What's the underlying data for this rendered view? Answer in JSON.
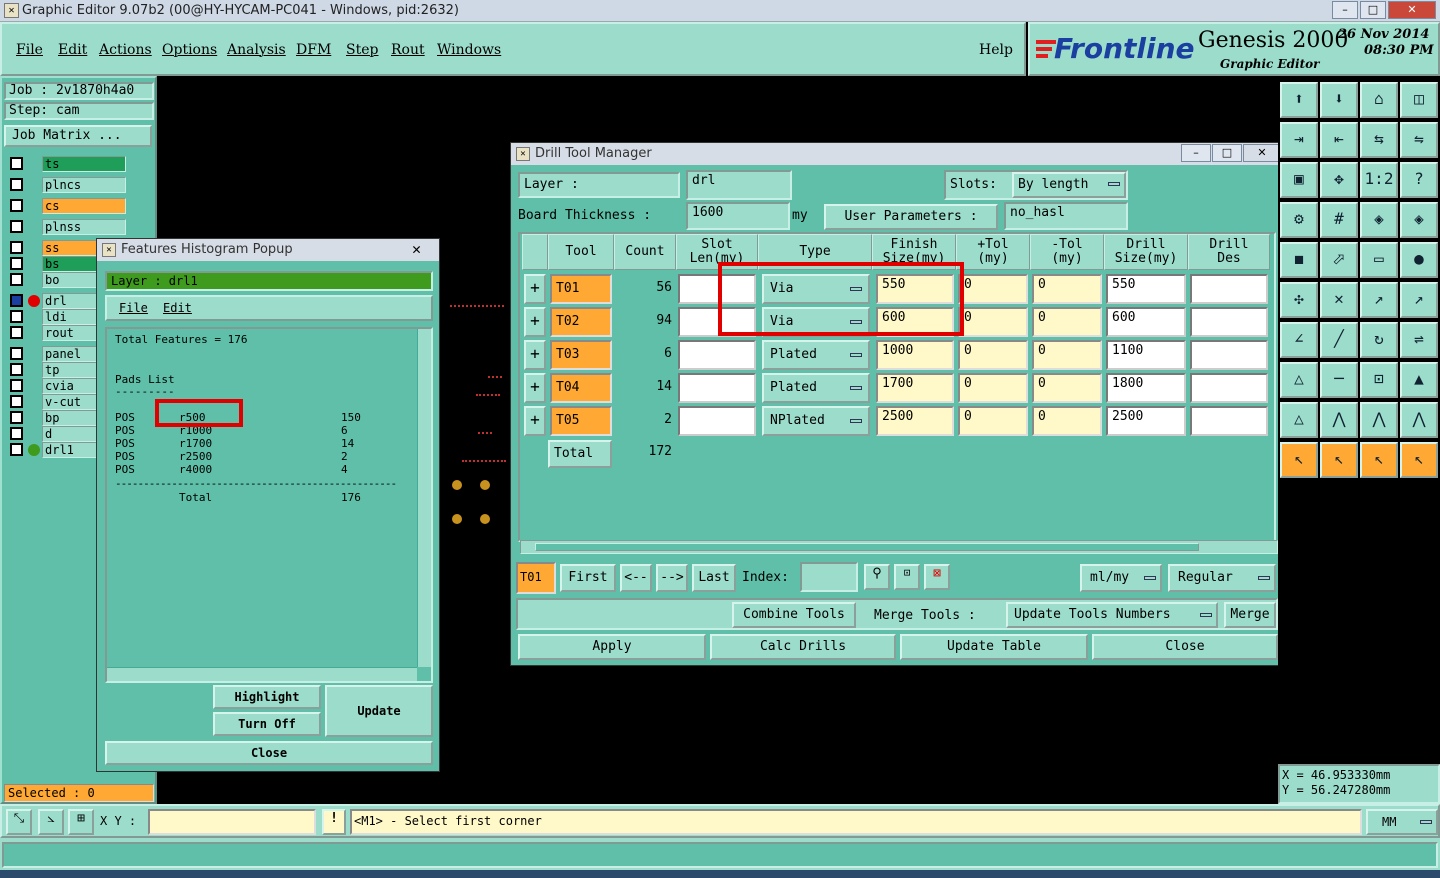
{
  "window": {
    "title": "Graphic Editor 9.07b2 (00@HY-HYCAM-PC041 - Windows, pid:2632)"
  },
  "menu": {
    "items": [
      "File",
      "Edit",
      "Actions",
      "Options",
      "Analysis",
      "DFM",
      "Step",
      "Rout",
      "Windows"
    ],
    "help": "Help"
  },
  "logo": {
    "brand": "Frontline",
    "product": "Genesis 2000",
    "subtitle": "Graphic Editor",
    "date": "26 Nov 2014",
    "time": "08:30 PM"
  },
  "job": {
    "job_label": "Job  : 2v1870h4a0",
    "step_label": "Step: cam",
    "job_matrix": "Job Matrix ..."
  },
  "layers": [
    {
      "name": "ts",
      "color": "#1f9e5a"
    },
    {
      "name": "plncs",
      "color": "#9cdccb"
    },
    {
      "name": "cs",
      "color": "#ffa934"
    },
    {
      "name": "plnss",
      "color": "#9cdccb"
    },
    {
      "name": "ss",
      "color": "#ffa934"
    },
    {
      "name": "bs",
      "color": "#1f9e5a"
    },
    {
      "name": "bo",
      "color": "#9cdccb"
    },
    {
      "name": "drl",
      "color": "#9cdccb"
    },
    {
      "name": "ldi",
      "color": "#9cdccb"
    },
    {
      "name": "rout",
      "color": "#9cdccb"
    },
    {
      "name": "panel",
      "color": "#9cdccb"
    },
    {
      "name": "tp",
      "color": "#9cdccb"
    },
    {
      "name": "cvia",
      "color": "#9cdccb"
    },
    {
      "name": "v-cut",
      "color": "#9cdccb"
    },
    {
      "name": "bp",
      "color": "#9cdccb"
    },
    {
      "name": "d",
      "color": "#9cdccb"
    },
    {
      "name": "drl1",
      "color": "#9cdccb"
    }
  ],
  "selected": "Selected : 0",
  "histogram": {
    "title": "Features Histogram Popup",
    "layer": "Layer  :  drl1",
    "menu": [
      "File",
      "Edit"
    ],
    "total_features": "Total Features = 176",
    "pads_list": "Pads List",
    "underline": "---------",
    "rows": [
      {
        "kind": "POS",
        "sym": "r500",
        "count": "150"
      },
      {
        "kind": "POS",
        "sym": "r1000",
        "count": "6"
      },
      {
        "kind": "POS",
        "sym": "r1700",
        "count": "14"
      },
      {
        "kind": "POS",
        "sym": "r2500",
        "count": "2"
      },
      {
        "kind": "POS",
        "sym": "r4000",
        "count": "4"
      }
    ],
    "sep": "--------------------------------------------------",
    "total_label": "Total",
    "total_value": "176",
    "buttons": {
      "highlight": "Highlight",
      "turn_off": "Turn Off",
      "update": "Update",
      "close": "Close"
    }
  },
  "drill": {
    "title": "Drill Tool Manager",
    "layer_label": "Layer          :",
    "layer_value": "drl",
    "slots_label": "Slots:",
    "slots_value": "By length",
    "board_label": "Board Thickness  :",
    "board_value": "1600",
    "board_unit": "my",
    "user_params": "User Parameters  :",
    "user_params_value": "no_hasl",
    "headers": [
      "Tool",
      "Count",
      "Slot\nLen(my)",
      "Type",
      "Finish\nSize(my)",
      "+Tol\n(my)",
      "-Tol\n(my)",
      "Drill\nSize(my)",
      "Drill\nDes"
    ],
    "rows": [
      {
        "tool": "T01",
        "count": "56",
        "type": "Via",
        "finish": "550",
        "ptol": "0",
        "mtol": "0",
        "drill": "550"
      },
      {
        "tool": "T02",
        "count": "94",
        "type": "Via",
        "finish": "600",
        "ptol": "0",
        "mtol": "0",
        "drill": "600"
      },
      {
        "tool": "T03",
        "count": "6",
        "type": "Plated",
        "finish": "1000",
        "ptol": "0",
        "mtol": "0",
        "drill": "1100"
      },
      {
        "tool": "T04",
        "count": "14",
        "type": "Plated",
        "finish": "1700",
        "ptol": "0",
        "mtol": "0",
        "drill": "1800"
      },
      {
        "tool": "T05",
        "count": "2",
        "type": "NPlated",
        "finish": "2500",
        "ptol": "0",
        "mtol": "0",
        "drill": "2500"
      }
    ],
    "total_label": "Total",
    "total_value": "172",
    "nav": {
      "current": "T01",
      "first": "First",
      "prev": "<--",
      "next": "-->",
      "last": "Last",
      "index": "Index:",
      "units": "ml/my",
      "mode": "Regular"
    },
    "actions": {
      "combine": "Combine Tools",
      "merge_tools": "Merge Tools :",
      "update_numbers": "Update Tools Numbers",
      "merge": "Merge"
    },
    "bottom": {
      "apply": "Apply",
      "calc": "Calc Drills",
      "update_table": "Update Table",
      "close": "Close"
    }
  },
  "coords": {
    "x": "X  =  46.953330mm",
    "y": "Y  =  56.247280mm"
  },
  "status": {
    "xy_label": "X Y :",
    "prompt": "<M1> - Select first corner",
    "units": "MM"
  }
}
